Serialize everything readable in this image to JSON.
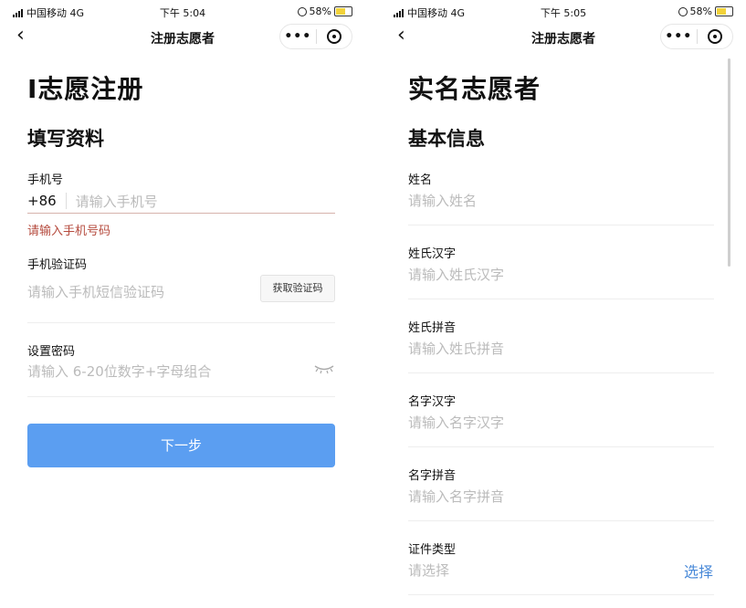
{
  "left": {
    "status": {
      "carrier": "中国移动",
      "network": "4G",
      "time": "下午 5:04",
      "battery": "58%"
    },
    "nav": {
      "title": "注册志愿者",
      "more": "•••"
    },
    "heading": "I志愿注册",
    "subheading": "填写资料",
    "phone": {
      "label": "手机号",
      "prefix": "+86",
      "placeholder": "请输入手机号",
      "error": "请输入手机号码"
    },
    "code": {
      "label": "手机验证码",
      "placeholder": "请输入手机短信验证码",
      "button": "获取验证码"
    },
    "password": {
      "label": "设置密码",
      "placeholder": "请输入 6-20位数字+字母组合"
    },
    "next_button": "下一步"
  },
  "right": {
    "status": {
      "carrier": "中国移动",
      "network": "4G",
      "time": "下午 5:05",
      "battery": "58%"
    },
    "nav": {
      "title": "注册志愿者",
      "more": "•••"
    },
    "heading": "实名志愿者",
    "subheading": "基本信息",
    "fields": [
      {
        "label": "姓名",
        "placeholder": "请输入姓名"
      },
      {
        "label": "姓氏汉字",
        "placeholder": "请输入姓氏汉字"
      },
      {
        "label": "姓氏拼音",
        "placeholder": "请输入姓氏拼音"
      },
      {
        "label": "名字汉字",
        "placeholder": "请输入名字汉字"
      },
      {
        "label": "名字拼音",
        "placeholder": "请输入名字拼音"
      },
      {
        "label": "证件类型",
        "placeholder": "请选择"
      }
    ],
    "select_label": "选择"
  },
  "colors": {
    "primary_button": "#5b9ef1",
    "error": "#b54a3d",
    "link": "#4a8ad8",
    "placeholder": "#bbbbbb"
  }
}
